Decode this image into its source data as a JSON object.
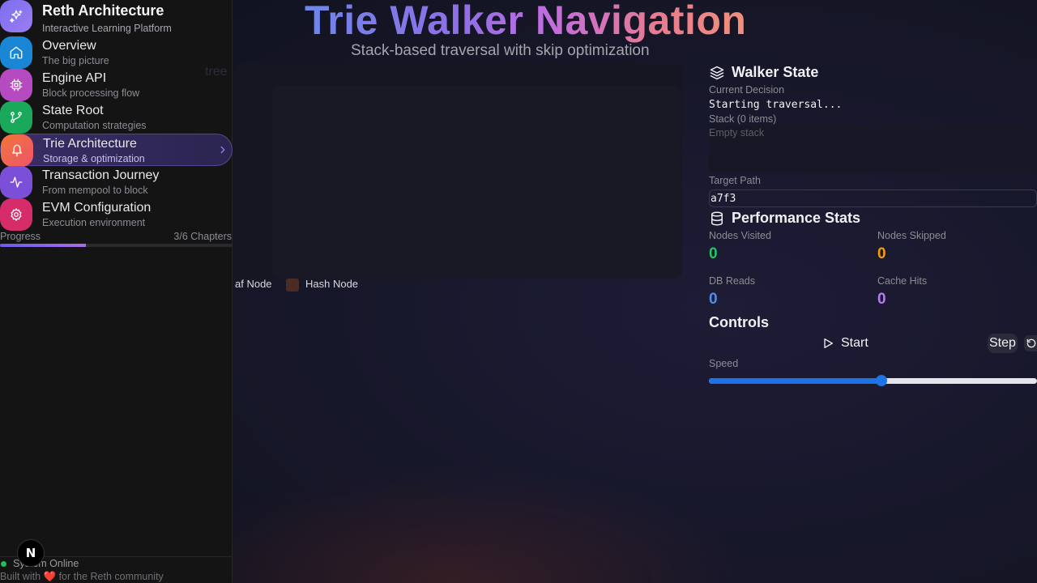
{
  "brand": {
    "title": "Reth Architecture",
    "subtitle": "Interactive Learning Platform",
    "icon": "sparkles-icon",
    "color": "#7b6ff0"
  },
  "nav": {
    "items": [
      {
        "title": "Overview",
        "subtitle": "The big picture",
        "icon": "home-icon",
        "color": "#1a86d6"
      },
      {
        "title": "Engine API",
        "subtitle": "Block processing flow",
        "icon": "cpu-icon",
        "color": "#b64ac0"
      },
      {
        "title": "State Root",
        "subtitle": "Computation strategies",
        "icon": "git-branch-icon",
        "color": "#1aa85a"
      },
      {
        "title": "Trie Architecture",
        "subtitle": "Storage & optimization",
        "icon": "tree-icon",
        "color": "#f0753a",
        "active": true
      },
      {
        "title": "Transaction Journey",
        "subtitle": "From mempool to block",
        "icon": "activity-icon",
        "color": "#7b4fd8"
      },
      {
        "title": "EVM Configuration",
        "subtitle": "Execution environment",
        "icon": "gear-icon",
        "color": "#d62c6a"
      }
    ]
  },
  "progress": {
    "label": "Progress",
    "count": "3/6 Chapters",
    "fraction": 0.37
  },
  "footer": {
    "status": "System Online",
    "built_prefix": "Built with",
    "built_suffix": "for the Reth community",
    "heart": "❤️"
  },
  "badge": {
    "letter": "N"
  },
  "header": {
    "title": "Trie Walker Navigation",
    "subtitle": "Stack-based traversal with skip optimization"
  },
  "canvas": {
    "ghost_label": "tree"
  },
  "legend": {
    "leaf_label": "af Node",
    "hash_label": "Hash Node",
    "hash_color": "#4a2c24"
  },
  "walker": {
    "title": "Walker State",
    "icon": "layers-icon",
    "decision_label": "Current Decision",
    "decision_value": "Starting traversal...",
    "stack_label": "Stack (0 items)",
    "stack_empty": "Empty stack",
    "target_label": "Target Path",
    "target_value": "a7f3"
  },
  "stats": {
    "title": "Performance Stats",
    "icon": "database-icon",
    "nodes_visited": {
      "label": "Nodes Visited",
      "value": "0",
      "color": "#22c55e"
    },
    "nodes_skipped": {
      "label": "Nodes Skipped",
      "value": "0",
      "color": "#f59e0b"
    },
    "db_reads": {
      "label": "DB Reads",
      "value": "0",
      "color": "#4f8fe6"
    },
    "cache_hits": {
      "label": "Cache Hits",
      "value": "0",
      "color": "#b57cf0"
    }
  },
  "controls": {
    "title": "Controls",
    "start_label": "Start",
    "step_label": "Step",
    "speed_label": "Speed",
    "speed_fraction": 0.525
  }
}
